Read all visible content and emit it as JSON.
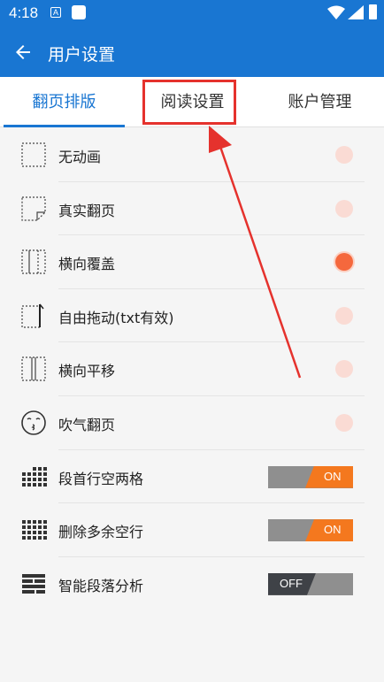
{
  "status": {
    "time": "4:18",
    "a_glyph": "A"
  },
  "appbar": {
    "title": "用户设置"
  },
  "tabs": [
    {
      "label": "翻页排版"
    },
    {
      "label": "阅读设置"
    },
    {
      "label": "账户管理"
    }
  ],
  "colors": {
    "primary": "#1976d2",
    "accent": "#f5683d",
    "highlight": "#e5322d",
    "toggle_on": "#f4781e"
  },
  "page_turn": [
    {
      "label": "无动画",
      "icon": "dotted-rect-icon",
      "checked": false
    },
    {
      "label": "真实翻页",
      "icon": "page-curl-icon",
      "checked": false
    },
    {
      "label": "横向覆盖",
      "icon": "cover-icon",
      "checked": true
    },
    {
      "label": "自由拖动(txt有效)",
      "icon": "drag-icon",
      "checked": false
    },
    {
      "label": "横向平移",
      "icon": "slide-icon",
      "checked": false
    },
    {
      "label": "吹气翻页",
      "icon": "blow-face-icon",
      "checked": false
    }
  ],
  "layout_options": [
    {
      "label": "段首行空两格",
      "icon": "indent-grid-icon",
      "state": "ON"
    },
    {
      "label": "删除多余空行",
      "icon": "full-grid-icon",
      "state": "ON"
    },
    {
      "label": "智能段落分析",
      "icon": "paragraph-icon",
      "state": "OFF"
    }
  ]
}
